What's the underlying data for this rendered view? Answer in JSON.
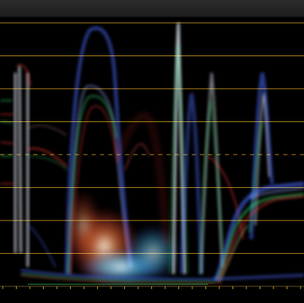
{
  "window": {
    "title": "",
    "background": "#000000",
    "title_bar_color": "#222222"
  },
  "scope": {
    "type": "rgb-parade-overlay-waveform",
    "graticule_color": "#d9a520",
    "graticule_levels": 9,
    "dashed_level_index": 4,
    "trace_colors": {
      "red": "#ff3a3a",
      "green": "#36d46a",
      "blue": "#4c6bff",
      "white": "#e8f0ff"
    }
  }
}
